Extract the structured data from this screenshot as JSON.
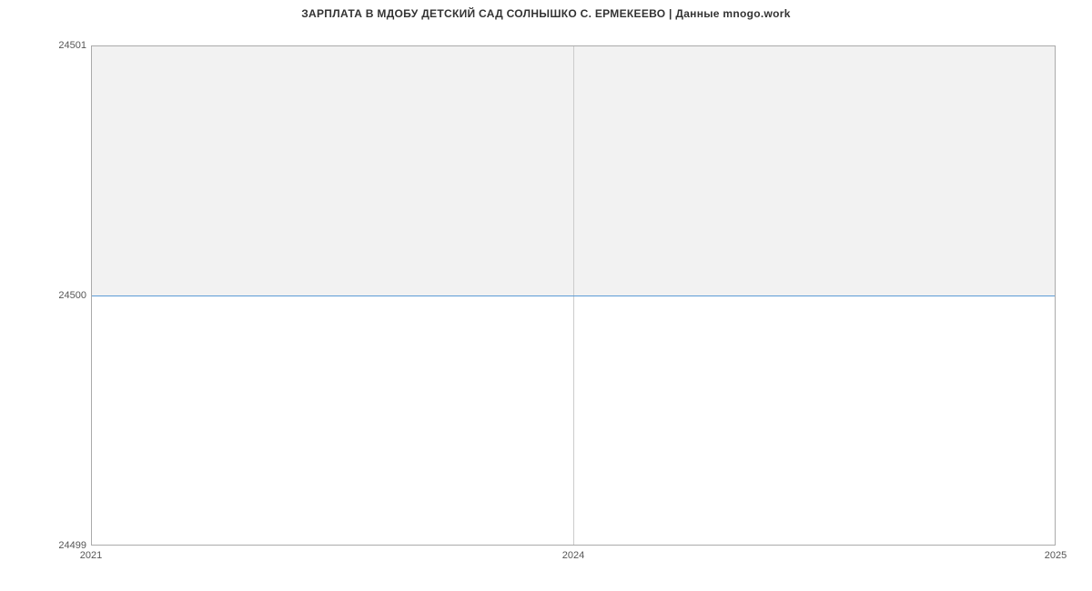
{
  "title": "ЗАРПЛАТА В МДОБУ ДЕТСКИЙ САД СОЛНЫШКО С. ЕРМЕКЕЕВО | Данные mnogo.work",
  "chart_data": {
    "type": "line",
    "title": "ЗАРПЛАТА В МДОБУ ДЕТСКИЙ САД СОЛНЫШКО С. ЕРМЕКЕЕВО | Данные mnogo.work",
    "xlabel": "",
    "ylabel": "",
    "x": [
      2021,
      2024,
      2025
    ],
    "y": [
      24500,
      24500,
      24500
    ],
    "xlim": [
      2021,
      2025
    ],
    "ylim": [
      24499,
      24501
    ],
    "xticks": [
      2021,
      2024,
      2025
    ],
    "yticks": [
      24499,
      24500,
      24501
    ]
  },
  "yticks": {
    "t0": "24499",
    "t1": "24500",
    "t2": "24501"
  },
  "xticks": {
    "t0": "2021",
    "t1": "2024",
    "t2": "2025"
  }
}
